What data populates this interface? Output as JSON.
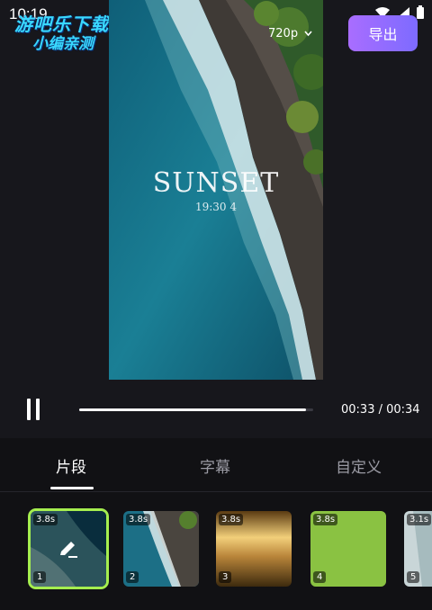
{
  "status_bar": {
    "time": "10:19"
  },
  "watermark": {
    "line1": "游吧乐下载",
    "line2": "小编亲测"
  },
  "header": {
    "resolution": "720p",
    "export_label": "导出"
  },
  "video": {
    "title": "SUNSET",
    "subtitle": "19:30 4"
  },
  "playback": {
    "state": "paused",
    "progress": 0.97,
    "time": "00:33 / 00:34"
  },
  "tabs": [
    {
      "label": "片段",
      "active": true
    },
    {
      "label": "字幕",
      "active": false
    },
    {
      "label": "自定义",
      "active": false
    }
  ],
  "clips": [
    {
      "duration": "3.8s",
      "index": "1",
      "selected": true
    },
    {
      "duration": "3.8s",
      "index": "2",
      "selected": false
    },
    {
      "duration": "3.8s",
      "index": "3",
      "selected": false
    },
    {
      "duration": "3.8s",
      "index": "4",
      "selected": false
    },
    {
      "duration": "3.1s",
      "index": "5",
      "selected": false
    }
  ],
  "colors": {
    "accent_gradient_start": "#a96dff",
    "accent_gradient_end": "#7d6bff",
    "selected_outline": "#a5ee4f",
    "background": "#17171c"
  }
}
